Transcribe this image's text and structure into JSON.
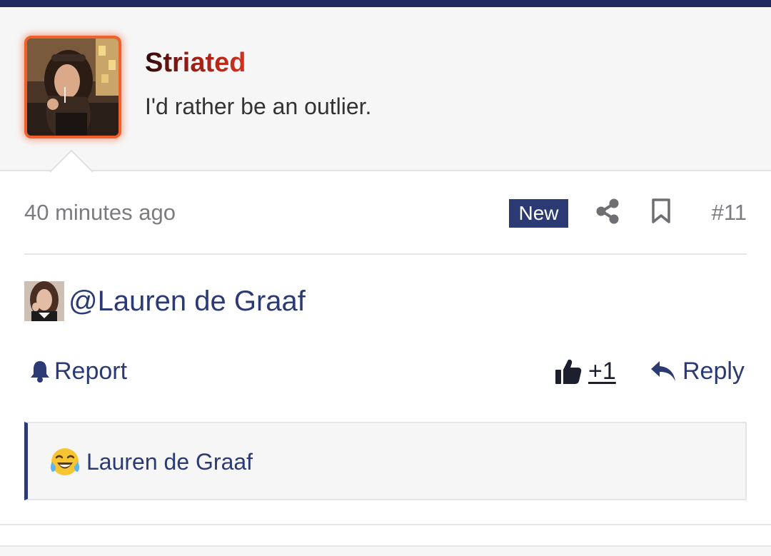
{
  "author": {
    "name": "Striated",
    "title": "I'd rather be an outlier.",
    "avatar_icon": "user-photo",
    "avatar_glow_color": "#f0602c"
  },
  "meta": {
    "timestamp": "40 minutes ago",
    "badge": "New",
    "share_icon": "share-icon",
    "bookmark_icon": "bookmark-icon",
    "post_number": "#11"
  },
  "post": {
    "mention": "@Lauren de Graaf"
  },
  "actions": {
    "report_label": "Report",
    "like_count": "+1",
    "reply_label": "Reply"
  },
  "signature": {
    "emoji_icon": "laughing-crying-emoji",
    "text": "Lauren de Graaf"
  },
  "colors": {
    "accent": "#2b3a73",
    "top_bar": "#1f2a5e",
    "panel_bg": "#f6f6f7",
    "muted_text": "#7c7c80"
  }
}
